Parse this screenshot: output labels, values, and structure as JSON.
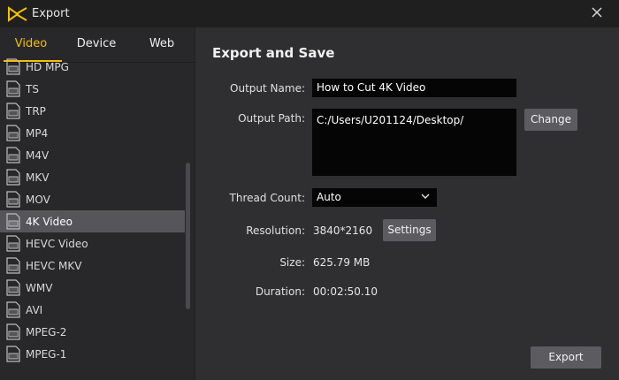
{
  "window": {
    "title": "Export",
    "close_icon": "close-icon",
    "logo_icon": "app-logo-icon"
  },
  "tabs": [
    {
      "label": "Video"
    },
    {
      "label": "Device"
    },
    {
      "label": "Web"
    }
  ],
  "active_tab": "Video",
  "formats": [
    {
      "label": "HD MPG"
    },
    {
      "label": "TS"
    },
    {
      "label": "TRP"
    },
    {
      "label": "MP4"
    },
    {
      "label": "M4V"
    },
    {
      "label": "MKV"
    },
    {
      "label": "MOV"
    },
    {
      "label": "4K Video"
    },
    {
      "label": "HEVC Video"
    },
    {
      "label": "HEVC MKV"
    },
    {
      "label": "WMV"
    },
    {
      "label": "AVI"
    },
    {
      "label": "MPEG-2"
    },
    {
      "label": "MPEG-1"
    }
  ],
  "selected_format": "4K Video",
  "main": {
    "heading": "Export and Save",
    "output_name_label": "Output Name:",
    "output_name_value": "How to Cut 4K Video",
    "output_path_label": "Output Path:",
    "output_path_value": "C:/Users/U201124/Desktop/",
    "change_button": "Change",
    "thread_count_label": "Thread Count:",
    "thread_count_value": "Auto",
    "resolution_label": "Resolution:",
    "resolution_value": "3840*2160",
    "settings_button": "Settings",
    "size_label": "Size:",
    "size_value": "625.79 MB",
    "duration_label": "Duration:",
    "duration_value": "00:02:50.10",
    "export_button": "Export"
  },
  "colors": {
    "accent": "#f4c000",
    "selected_row": "#56565a",
    "button": "#5c5c60"
  }
}
